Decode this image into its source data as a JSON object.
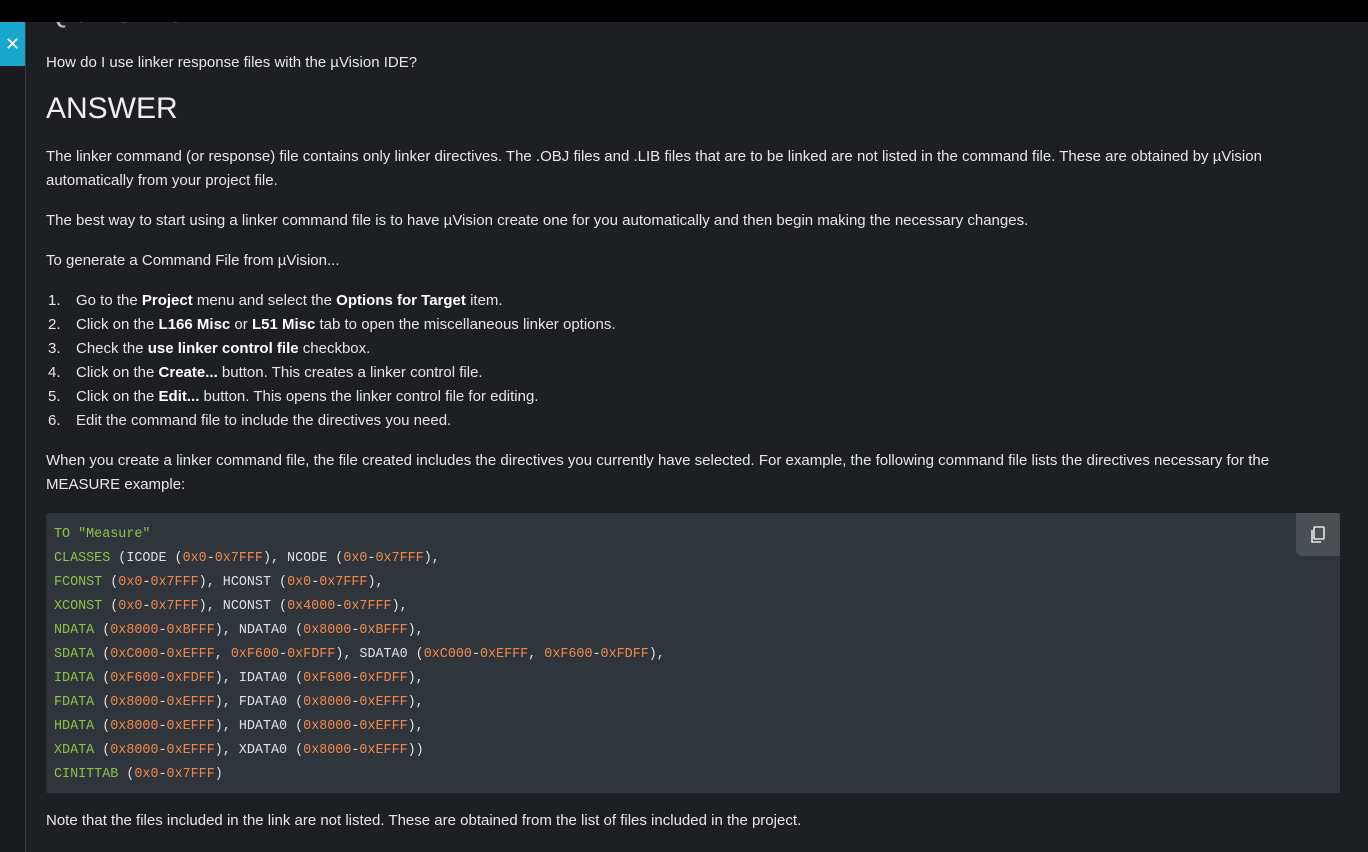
{
  "question_heading": "QUESTION",
  "question_text": "How do I use linker response files with the µVision IDE?",
  "answer_heading": "ANSWER",
  "para1": "The linker command (or response) file contains only linker directives. The .OBJ files and .LIB files that are to be linked are not listed in the command file. These are obtained by µVision automatically from your project file.",
  "para2": "The best way to start using a linker command file is to have µVision create one for you automatically and then begin making the necessary changes.",
  "para3": "To generate a Command File from µVision...",
  "steps": [
    {
      "n": "1.",
      "a": "Go to the ",
      "b1": "Project",
      "c": " menu and select the ",
      "b2": "Options for Target",
      "d": " item."
    },
    {
      "n": "2.",
      "a": "Click on the ",
      "b1": "L166 Misc",
      "c": " or ",
      "b2": "L51 Misc",
      "d": " tab to open the miscellaneous linker options."
    },
    {
      "n": "3.",
      "a": "Check the ",
      "b1": "use linker control file",
      "c": " checkbox.",
      "b2": "",
      "d": ""
    },
    {
      "n": "4.",
      "a": "Click on the ",
      "b1": "Create...",
      "c": " button. This creates a linker control file.",
      "b2": "",
      "d": ""
    },
    {
      "n": "5.",
      "a": "Click on the ",
      "b1": "Edit...",
      "c": " button. This opens the linker control file for editing.",
      "b2": "",
      "d": ""
    },
    {
      "n": "6.",
      "a": "Edit the command file to include the directives you need.",
      "b1": "",
      "c": "",
      "b2": "",
      "d": ""
    }
  ],
  "para4": "When you create a linker command file, the file created includes the directives you currently have selected. For example, the following command file lists the directives necessary for the MEASURE example:",
  "code_lines": [
    [
      [
        "kw",
        "TO "
      ],
      [
        "str",
        "\"Measure\""
      ]
    ],
    [
      [
        "kw",
        "CLASSES"
      ],
      [
        "t",
        " (ICODE ("
      ],
      [
        "nm",
        "0x0"
      ],
      [
        "t",
        "-"
      ],
      [
        "nm",
        "0x7FFF"
      ],
      [
        "t",
        "), NCODE ("
      ],
      [
        "nm",
        "0x0"
      ],
      [
        "t",
        "-"
      ],
      [
        "nm",
        "0x7FFF"
      ],
      [
        "t",
        "),"
      ]
    ],
    [
      [
        "kw",
        "FCONST"
      ],
      [
        "t",
        " ("
      ],
      [
        "nm",
        "0x0"
      ],
      [
        "t",
        "-"
      ],
      [
        "nm",
        "0x7FFF"
      ],
      [
        "t",
        "), HCONST ("
      ],
      [
        "nm",
        "0x0"
      ],
      [
        "t",
        "-"
      ],
      [
        "nm",
        "0x7FFF"
      ],
      [
        "t",
        "),"
      ]
    ],
    [
      [
        "kw",
        "XCONST"
      ],
      [
        "t",
        " ("
      ],
      [
        "nm",
        "0x0"
      ],
      [
        "t",
        "-"
      ],
      [
        "nm",
        "0x7FFF"
      ],
      [
        "t",
        "), NCONST ("
      ],
      [
        "nm",
        "0x4000"
      ],
      [
        "t",
        "-"
      ],
      [
        "nm",
        "0x7FFF"
      ],
      [
        "t",
        "),"
      ]
    ],
    [
      [
        "kw",
        "NDATA"
      ],
      [
        "t",
        " ("
      ],
      [
        "nm",
        "0x8000"
      ],
      [
        "t",
        "-"
      ],
      [
        "nm",
        "0xBFFF"
      ],
      [
        "t",
        "), NDATA0 ("
      ],
      [
        "nm",
        "0x8000"
      ],
      [
        "t",
        "-"
      ],
      [
        "nm",
        "0xBFFF"
      ],
      [
        "t",
        "),"
      ]
    ],
    [
      [
        "kw",
        "SDATA"
      ],
      [
        "t",
        " ("
      ],
      [
        "nm",
        "0xC000"
      ],
      [
        "t",
        "-"
      ],
      [
        "nm",
        "0xEFFF"
      ],
      [
        "t",
        ", "
      ],
      [
        "nm",
        "0xF600"
      ],
      [
        "t",
        "-"
      ],
      [
        "nm",
        "0xFDFF"
      ],
      [
        "t",
        "), SDATA0 ("
      ],
      [
        "nm",
        "0xC000"
      ],
      [
        "t",
        "-"
      ],
      [
        "nm",
        "0xEFFF"
      ],
      [
        "t",
        ", "
      ],
      [
        "nm",
        "0xF600"
      ],
      [
        "t",
        "-"
      ],
      [
        "nm",
        "0xFDFF"
      ],
      [
        "t",
        "),"
      ]
    ],
    [
      [
        "kw",
        "IDATA"
      ],
      [
        "t",
        " ("
      ],
      [
        "nm",
        "0xF600"
      ],
      [
        "t",
        "-"
      ],
      [
        "nm",
        "0xFDFF"
      ],
      [
        "t",
        "), IDATA0 ("
      ],
      [
        "nm",
        "0xF600"
      ],
      [
        "t",
        "-"
      ],
      [
        "nm",
        "0xFDFF"
      ],
      [
        "t",
        "),"
      ]
    ],
    [
      [
        "kw",
        "FDATA"
      ],
      [
        "t",
        " ("
      ],
      [
        "nm",
        "0x8000"
      ],
      [
        "t",
        "-"
      ],
      [
        "nm",
        "0xEFFF"
      ],
      [
        "t",
        "), FDATA0 ("
      ],
      [
        "nm",
        "0x8000"
      ],
      [
        "t",
        "-"
      ],
      [
        "nm",
        "0xEFFF"
      ],
      [
        "t",
        "),"
      ]
    ],
    [
      [
        "kw",
        "HDATA"
      ],
      [
        "t",
        " ("
      ],
      [
        "nm",
        "0x8000"
      ],
      [
        "t",
        "-"
      ],
      [
        "nm",
        "0xEFFF"
      ],
      [
        "t",
        "), HDATA0 ("
      ],
      [
        "nm",
        "0x8000"
      ],
      [
        "t",
        "-"
      ],
      [
        "nm",
        "0xEFFF"
      ],
      [
        "t",
        "),"
      ]
    ],
    [
      [
        "kw",
        "XDATA"
      ],
      [
        "t",
        " ("
      ],
      [
        "nm",
        "0x8000"
      ],
      [
        "t",
        "-"
      ],
      [
        "nm",
        "0xEFFF"
      ],
      [
        "t",
        "), XDATA0 ("
      ],
      [
        "nm",
        "0x8000"
      ],
      [
        "t",
        "-"
      ],
      [
        "nm",
        "0xEFFF"
      ],
      [
        "t",
        "))"
      ]
    ],
    [
      [
        "kw",
        "CINITTAB"
      ],
      [
        "t",
        " ("
      ],
      [
        "nm",
        "0x0"
      ],
      [
        "t",
        "-"
      ],
      [
        "nm",
        "0x7FFF"
      ],
      [
        "t",
        ")"
      ]
    ]
  ],
  "para5": "Note that the files included in the link are not listed. These are obtained from the list of files included in the project.",
  "icons": {
    "close": "close-icon",
    "copy": "copy-icon"
  },
  "colors": {
    "accent": "#17a6cc",
    "code_bg": "#2f353a",
    "keyword": "#8bc34a",
    "number": "#ef8a4d"
  }
}
